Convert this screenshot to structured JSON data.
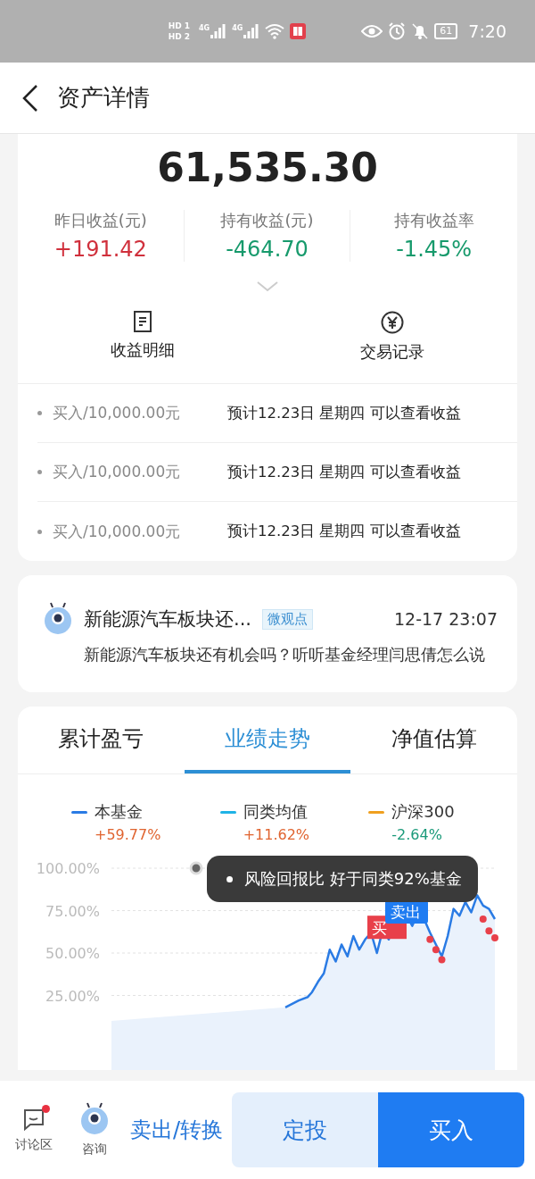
{
  "status_bar": {
    "sims": [
      {
        "hd": "HD",
        "slot": "1"
      },
      {
        "hd": "HD",
        "slot": "2"
      }
    ],
    "networks": [
      "4G",
      "4G"
    ],
    "battery": "61",
    "time": "7:20"
  },
  "header": {
    "title": "资产详情"
  },
  "summary": {
    "total": "61,535.30",
    "stats": [
      {
        "label": "昨日收益(元)",
        "value": "+191.42",
        "color": "#d0303c"
      },
      {
        "label": "持有收益(元)",
        "value": "-464.70",
        "color": "#179a6c"
      },
      {
        "label": "持有收益率",
        "value": "-1.45%",
        "color": "#179a6c"
      }
    ],
    "actions": [
      {
        "label": "收益明细"
      },
      {
        "label": "交易记录"
      }
    ],
    "pending": [
      {
        "amount": "买入/10,000.00元",
        "note": "预计12.23日 星期四 可以查看收益"
      },
      {
        "amount": "买入/10,000.00元",
        "note": "预计12.23日 星期四 可以查看收益"
      },
      {
        "amount": "买入/10,000.00元",
        "note": "预计12.23日 星期四 可以查看收益"
      }
    ]
  },
  "news": {
    "title": "新能源汽车板块还...",
    "tag": "微观点",
    "time": "12-17 23:07",
    "body": "新能源汽车板块还有机会吗？听听基金经理闫思倩怎么说"
  },
  "tabs": [
    {
      "label": "累计盈亏",
      "selected": false
    },
    {
      "label": "业绩走势",
      "selected": true
    },
    {
      "label": "净值估算",
      "selected": false
    }
  ],
  "legend": [
    {
      "name": "本基金",
      "value": "+59.77%",
      "color": "#2a7be4"
    },
    {
      "name": "同类均值",
      "value": "+11.62%",
      "color": "#1fb3e6"
    },
    {
      "name": "沪深300",
      "value": "-2.64%",
      "color": "#f0a020"
    }
  ],
  "chart": {
    "y_labels": [
      "100.00%",
      "75.00%",
      "50.00%",
      "25.00%"
    ],
    "markers": [
      {
        "kind": "buy",
        "text": "买"
      },
      {
        "kind": "sell",
        "text": "卖出"
      }
    ],
    "tooltip": "风险回报比 好于同类92%基金"
  },
  "bottom_bar": {
    "discuss": {
      "label": "讨论区",
      "badge": true
    },
    "consult": {
      "label": "咨询"
    },
    "sell": "卖出/转换",
    "plan": "定投",
    "buy": "买入"
  }
}
